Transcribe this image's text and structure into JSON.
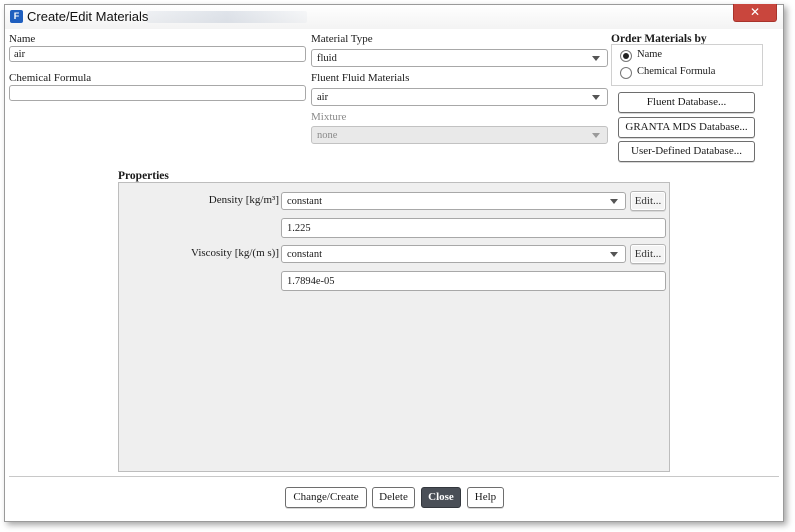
{
  "window": {
    "title": "Create/Edit Materials",
    "close_glyph": "✕"
  },
  "name": {
    "label": "Name",
    "value": "air"
  },
  "chemical_formula": {
    "label": "Chemical Formula",
    "value": ""
  },
  "material_type": {
    "label": "Material Type",
    "selected": "fluid"
  },
  "fluent_fluid_materials": {
    "label": "Fluent Fluid Materials",
    "selected": "air"
  },
  "mixture": {
    "label": "Mixture",
    "selected": "none",
    "enabled": false
  },
  "order_by": {
    "title": "Order Materials by",
    "options": [
      {
        "label": "Name",
        "selected": true
      },
      {
        "label": "Chemical Formula",
        "selected": false
      }
    ]
  },
  "database_buttons": {
    "fluent": "Fluent Database...",
    "granta": "GRANTA MDS Database...",
    "user_defined": "User-Defined Database..."
  },
  "properties": {
    "title": "Properties",
    "rows": [
      {
        "label": "Density [kg/m³]",
        "method": "constant",
        "edit_label": "Edit...",
        "value": "1.225"
      },
      {
        "label": "Viscosity [kg/(m s)]",
        "method": "constant",
        "edit_label": "Edit...",
        "value": "1.7894e-05"
      }
    ]
  },
  "actions": {
    "change_create": "Change/Create",
    "delete": "Delete",
    "close": "Close",
    "help": "Help"
  },
  "colors": {
    "close_button": "#c9463d",
    "primary_button": "#4a4f57",
    "panel_bg": "#efefef",
    "app_icon": "#1f5fbf"
  }
}
